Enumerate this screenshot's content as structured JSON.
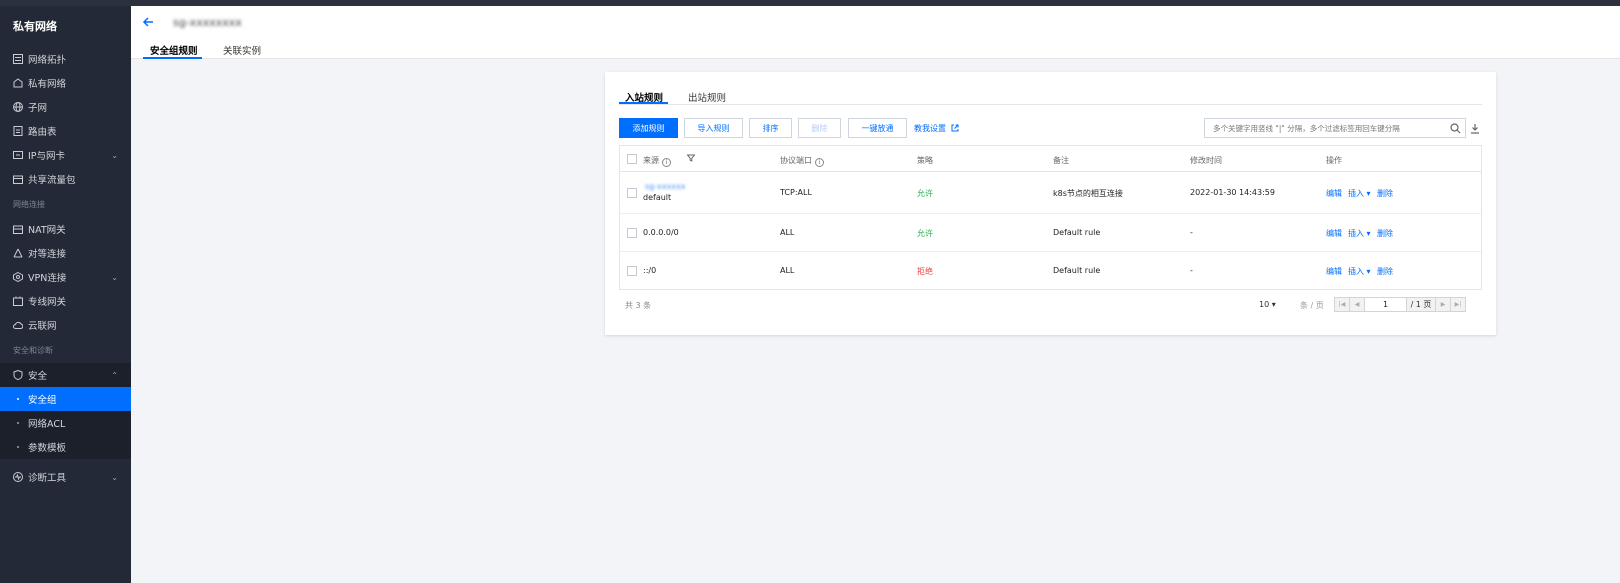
{
  "sidebar": {
    "title": "私有网络",
    "items": [
      {
        "label": "网络拓扑"
      },
      {
        "label": "私有网络"
      },
      {
        "label": "子网"
      },
      {
        "label": "路由表"
      },
      {
        "label": "IP与网卡"
      },
      {
        "label": "共享流量包"
      }
    ],
    "section_network": "网络连接",
    "net_items": [
      {
        "label": "NAT网关"
      },
      {
        "label": "对等连接"
      },
      {
        "label": "VPN连接"
      },
      {
        "label": "专线网关"
      },
      {
        "label": "云联网"
      }
    ],
    "section_security": "安全和诊断",
    "security": {
      "label": "安全",
      "children": [
        {
          "label": "安全组"
        },
        {
          "label": "网络ACL"
        },
        {
          "label": "参数模板"
        }
      ]
    },
    "diagnose": {
      "label": "诊断工具"
    }
  },
  "header": {
    "title_blurred": "sg-xxxxxxxx",
    "tabs": [
      {
        "label": "安全组规则"
      },
      {
        "label": "关联实例"
      }
    ]
  },
  "rules": {
    "subtabs": [
      {
        "label": "入站规则"
      },
      {
        "label": "出站规则"
      }
    ],
    "toolbar": {
      "add": "添加规则",
      "import": "导入规则",
      "sort": "排序",
      "delete": "删除",
      "open_all": "一键放通",
      "teach": "教我设置"
    },
    "search_placeholder": "多个关键字用竖线 \"|\" 分隔，多个过滤标签用回车键分隔",
    "columns": {
      "source": "来源",
      "protocol_port": "协议端口",
      "policy": "策略",
      "remark": "备注",
      "modified": "修改时间",
      "actions": "操作"
    },
    "rows": [
      {
        "source_link": "sg-xxxxxx",
        "source": "default",
        "protocol_port": "TCP:ALL",
        "policy": "允许",
        "remark": "k8s节点的相互连接",
        "modified": "2022-01-30 14:43:59"
      },
      {
        "source": "0.0.0.0/0",
        "protocol_port": "ALL",
        "policy": "允许",
        "remark": "Default rule",
        "modified": "-"
      },
      {
        "source": "::/0",
        "protocol_port": "ALL",
        "policy": "拒绝",
        "remark": "Default rule",
        "modified": "-"
      }
    ],
    "row_actions": {
      "edit": "编辑",
      "insert": "插入",
      "delete": "删除"
    },
    "footer": {
      "total": "共 3 条",
      "page_size": "10",
      "page_unit": "条 / 页",
      "page": "1",
      "page_total": "/ 1 页"
    }
  },
  "colors": {
    "accent": "#006eff",
    "allow": "#2bad4e",
    "deny": "#e54545",
    "sidebar_bg": "#232936"
  }
}
